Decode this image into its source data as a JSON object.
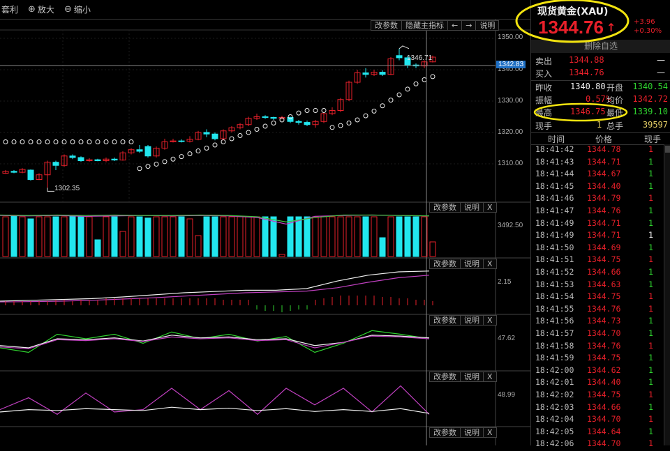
{
  "toolbar": {
    "arbitrage": "套利",
    "zoom_in": "放大",
    "zoom_out": "缩小"
  },
  "main_panel": {
    "buttons": [
      "改参数",
      "隐藏主指标",
      "←",
      "→",
      "说明"
    ],
    "axis_labels": [
      "1350.00",
      "1340.00",
      "1330.00",
      "1320.00",
      "1310.00"
    ],
    "current_price_tag": "1342.83",
    "high_marker": "1346.71",
    "low_marker": "1302.35"
  },
  "indicator_panels": [
    {
      "buttons": [
        "改参数",
        "说明",
        "X"
      ],
      "axis_label": "3492.50"
    },
    {
      "buttons": [
        "改参数",
        "说明",
        "X"
      ],
      "axis_label": "2.15"
    },
    {
      "buttons": [
        "改参数",
        "说明",
        "X"
      ],
      "axis_label": "47.62"
    },
    {
      "buttons": [
        "改参数",
        "说明",
        "X"
      ],
      "axis_label": "48.99"
    },
    {
      "buttons": [
        "改参数",
        "说明",
        "X"
      ],
      "axis_label": ""
    }
  ],
  "colors": {
    "up": "#e8202a",
    "down": "#22e6ee",
    "highlight": "#f2e30f"
  },
  "chart_data": {
    "type": "candlestick",
    "ylim": [
      1300,
      1352
    ],
    "ohlc": [
      [
        1307,
        1307.6,
        1308,
        1306.8
      ],
      [
        1307.6,
        1307.3,
        1308,
        1307
      ],
      [
        1307.3,
        1308.2,
        1308.6,
        1307
      ],
      [
        1308,
        1305,
        1308.2,
        1304.6
      ],
      [
        1305,
        1306.5,
        1307,
        1304.8
      ],
      [
        1306.5,
        1310.5,
        1311,
        1302.35
      ],
      [
        1310.5,
        1309.5,
        1311,
        1308
      ],
      [
        1309.5,
        1312.5,
        1313,
        1309
      ],
      [
        1312.5,
        1312,
        1313,
        1311.5
      ],
      [
        1312,
        1311,
        1312.4,
        1310.6
      ],
      [
        1311,
        1311.3,
        1311.8,
        1310.7
      ],
      [
        1311.3,
        1311,
        1311.6,
        1310.8
      ],
      [
        1311,
        1311.5,
        1312,
        1310.5
      ],
      [
        1311.5,
        1311.2,
        1312,
        1310.9
      ],
      [
        1311.2,
        1313.5,
        1314,
        1311
      ],
      [
        1313.5,
        1314.5,
        1315,
        1313
      ],
      [
        1314.5,
        1314,
        1316,
        1313.5
      ],
      [
        1315.5,
        1312.5,
        1316,
        1312
      ],
      [
        1312.5,
        1315,
        1315.5,
        1312
      ],
      [
        1315,
        1317,
        1318,
        1314.5
      ],
      [
        1317,
        1317.3,
        1318,
        1316.8
      ],
      [
        1317.3,
        1317.2,
        1317.8,
        1316.8
      ],
      [
        1317.2,
        1317.8,
        1318.8,
        1316.8
      ],
      [
        1317.8,
        1320,
        1320.5,
        1317.5
      ],
      [
        1320,
        1319.5,
        1321,
        1318.5
      ],
      [
        1319.5,
        1318,
        1320,
        1317.5
      ],
      [
        1318,
        1320.5,
        1321,
        1317.5
      ],
      [
        1320.5,
        1321.5,
        1322,
        1320
      ],
      [
        1321.5,
        1322.5,
        1323,
        1321
      ],
      [
        1322.5,
        1324.5,
        1325,
        1322
      ],
      [
        1324.5,
        1325,
        1326,
        1324
      ],
      [
        1325,
        1324.8,
        1325.5,
        1324.3
      ],
      [
        1324.8,
        1324.5,
        1325,
        1324
      ],
      [
        1324.5,
        1324.8,
        1325.3,
        1324.2
      ],
      [
        1324.8,
        1323.5,
        1325,
        1323
      ],
      [
        1323.5,
        1323.2,
        1324,
        1322.5
      ],
      [
        1323.2,
        1322.5,
        1323.8,
        1322
      ],
      [
        1322.5,
        1323.5,
        1324,
        1321.5
      ],
      [
        1323.5,
        1326,
        1326.5,
        1323
      ],
      [
        1326,
        1327,
        1328,
        1325.5
      ],
      [
        1327,
        1330.5,
        1331,
        1326.5
      ],
      [
        1330.5,
        1336,
        1336.5,
        1330
      ],
      [
        1336,
        1339,
        1340,
        1335.5
      ],
      [
        1339,
        1338.5,
        1340.5,
        1337.5
      ],
      [
        1338.5,
        1339.2,
        1340,
        1338
      ],
      [
        1339.2,
        1338.5,
        1339.8,
        1338
      ],
      [
        1338.5,
        1343.5,
        1344,
        1338.3
      ],
      [
        1344.5,
        1343.8,
        1346.71,
        1343
      ],
      [
        1343.8,
        1341.5,
        1344.5,
        1340.5
      ],
      [
        1341.5,
        1341.2,
        1342,
        1340.5
      ],
      [
        1341.2,
        1342.5,
        1343,
        1340.5
      ],
      [
        1342.5,
        1344,
        1344.5,
        1342.3
      ]
    ],
    "sar": [
      1317,
      1317,
      1317,
      1317,
      1317,
      1317,
      1317,
      1317,
      1317,
      1317,
      1317,
      1317,
      1317,
      1317,
      1317,
      1317,
      1308.5,
      1309.2,
      1309.9,
      1310.7,
      1311.5,
      1312.3,
      1313.2,
      1314.1,
      1315,
      1316,
      1317,
      1318,
      1319,
      1320,
      1321,
      1322,
      1323,
      1324,
      1325,
      1326.2,
      1327,
      1327,
      1327,
      1321.6,
      1322.2,
      1323,
      1324,
      1325.3,
      1326.8,
      1328.5,
      1330.3,
      1332,
      1333.8,
      1335.5,
      1336.8,
      1337.8
    ],
    "volume": [
      95,
      96,
      95,
      90,
      95,
      95,
      95,
      95,
      96,
      95,
      95,
      40,
      95,
      95,
      60,
      95,
      95,
      92,
      95,
      95,
      95,
      95,
      90,
      50,
      95,
      95,
      95,
      95,
      95,
      95,
      95,
      95,
      95,
      5,
      95,
      95,
      95,
      95,
      95,
      95,
      95,
      95,
      95,
      95,
      95,
      45,
      95,
      95,
      95,
      95,
      95,
      35
    ],
    "macd_lines": [
      [
        10,
        12,
        14,
        16,
        20,
        25,
        30,
        33,
        36,
        36,
        40,
        58,
        72,
        80,
        82
      ],
      [
        8,
        9,
        10,
        12,
        15,
        18,
        22,
        26,
        30,
        32,
        34,
        42,
        55,
        66,
        72
      ]
    ],
    "macd_hist": [
      3,
      3,
      3,
      3,
      3,
      3,
      4,
      4,
      3,
      4,
      4,
      4,
      5,
      5,
      5,
      5,
      5,
      5,
      5,
      5,
      5,
      5,
      5,
      5,
      5,
      5,
      4,
      4,
      4,
      4,
      -3,
      -4,
      -4,
      -5,
      -4,
      -3,
      -3,
      4,
      5,
      6,
      7,
      7,
      7,
      7,
      7,
      6,
      6,
      5,
      5,
      4,
      4,
      3
    ],
    "kdj_lines": [
      [
        40,
        30,
        70,
        60,
        70,
        50,
        75,
        60,
        70,
        55,
        65,
        30,
        50,
        78,
        70,
        60
      ],
      [
        45,
        40,
        60,
        58,
        62,
        55,
        68,
        62,
        64,
        58,
        60,
        45,
        52,
        68,
        66,
        62
      ],
      [
        42,
        38,
        58,
        56,
        60,
        54,
        64,
        60,
        62,
        56,
        58,
        40,
        52,
        66,
        64,
        60
      ]
    ],
    "rsi_lines": [
      [
        30,
        55,
        20,
        65,
        25,
        30,
        75,
        30,
        70,
        20,
        75,
        40,
        75,
        25,
        80,
        20
      ],
      [
        25,
        30,
        28,
        32,
        30,
        28,
        35,
        30,
        33,
        28,
        32,
        26,
        30,
        26,
        32,
        22
      ]
    ]
  },
  "quote": {
    "title": "现货黄金(XAU)",
    "price": "1344.76",
    "arrow": "↑",
    "change": "+3.96",
    "change_pct": "+0.30%",
    "remove_watch": "删除自选",
    "sell_label": "卖出",
    "sell_price": "1344.88",
    "sell_vol": "—",
    "buy_label": "买入",
    "buy_price": "1344.76",
    "buy_vol": "—",
    "prev_close_label": "昨收",
    "prev_close": "1340.80",
    "open_label": "开盘",
    "open": "1340.54",
    "amplitude_label": "振幅",
    "amplitude": "0.57%",
    "avg_label": "均价",
    "avg": "1342.72",
    "high_label": "最高",
    "high": "1346.75",
    "low_label": "最低",
    "low": "1339.10",
    "cur_vol_label": "现手",
    "cur_vol": "1",
    "total_vol_label": "总手",
    "total_vol": "39597"
  },
  "ticks_header": {
    "time": "时间",
    "price": "价格",
    "vol": "现手"
  },
  "ticks": [
    {
      "time": "18:41:42",
      "price": "1344.78",
      "vol": "1",
      "dir": "up"
    },
    {
      "time": "18:41:43",
      "price": "1344.71",
      "vol": "1",
      "dir": "down"
    },
    {
      "time": "18:41:44",
      "price": "1344.67",
      "vol": "1",
      "dir": "down"
    },
    {
      "time": "18:41:45",
      "price": "1344.40",
      "vol": "1",
      "dir": "down"
    },
    {
      "time": "18:41:46",
      "price": "1344.79",
      "vol": "1",
      "dir": "up"
    },
    {
      "time": "18:41:47",
      "price": "1344.76",
      "vol": "1",
      "dir": "down"
    },
    {
      "time": "18:41:49",
      "price": "1344.71",
      "vol": "1",
      "dir": "down"
    },
    {
      "time": "18:41:49",
      "price": "1344.71",
      "vol": "1",
      "dir": "flat"
    },
    {
      "time": "18:41:50",
      "price": "1344.69",
      "vol": "1",
      "dir": "down"
    },
    {
      "time": "18:41:51",
      "price": "1344.75",
      "vol": "1",
      "dir": "up"
    },
    {
      "time": "18:41:52",
      "price": "1344.66",
      "vol": "1",
      "dir": "down"
    },
    {
      "time": "18:41:53",
      "price": "1344.63",
      "vol": "1",
      "dir": "down"
    },
    {
      "time": "18:41:54",
      "price": "1344.75",
      "vol": "1",
      "dir": "up"
    },
    {
      "time": "18:41:55",
      "price": "1344.76",
      "vol": "1",
      "dir": "up"
    },
    {
      "time": "18:41:56",
      "price": "1344.73",
      "vol": "1",
      "dir": "down"
    },
    {
      "time": "18:41:57",
      "price": "1344.70",
      "vol": "1",
      "dir": "down"
    },
    {
      "time": "18:41:58",
      "price": "1344.76",
      "vol": "1",
      "dir": "up"
    },
    {
      "time": "18:41:59",
      "price": "1344.75",
      "vol": "1",
      "dir": "down"
    },
    {
      "time": "18:42:00",
      "price": "1344.62",
      "vol": "1",
      "dir": "down"
    },
    {
      "time": "18:42:01",
      "price": "1344.40",
      "vol": "1",
      "dir": "down"
    },
    {
      "time": "18:42:02",
      "price": "1344.75",
      "vol": "1",
      "dir": "up"
    },
    {
      "time": "18:42:03",
      "price": "1344.66",
      "vol": "1",
      "dir": "down"
    },
    {
      "time": "18:42:04",
      "price": "1344.70",
      "vol": "1",
      "dir": "up"
    },
    {
      "time": "18:42:05",
      "price": "1344.64",
      "vol": "1",
      "dir": "down"
    },
    {
      "time": "18:42:06",
      "price": "1344.70",
      "vol": "1",
      "dir": "up"
    }
  ]
}
